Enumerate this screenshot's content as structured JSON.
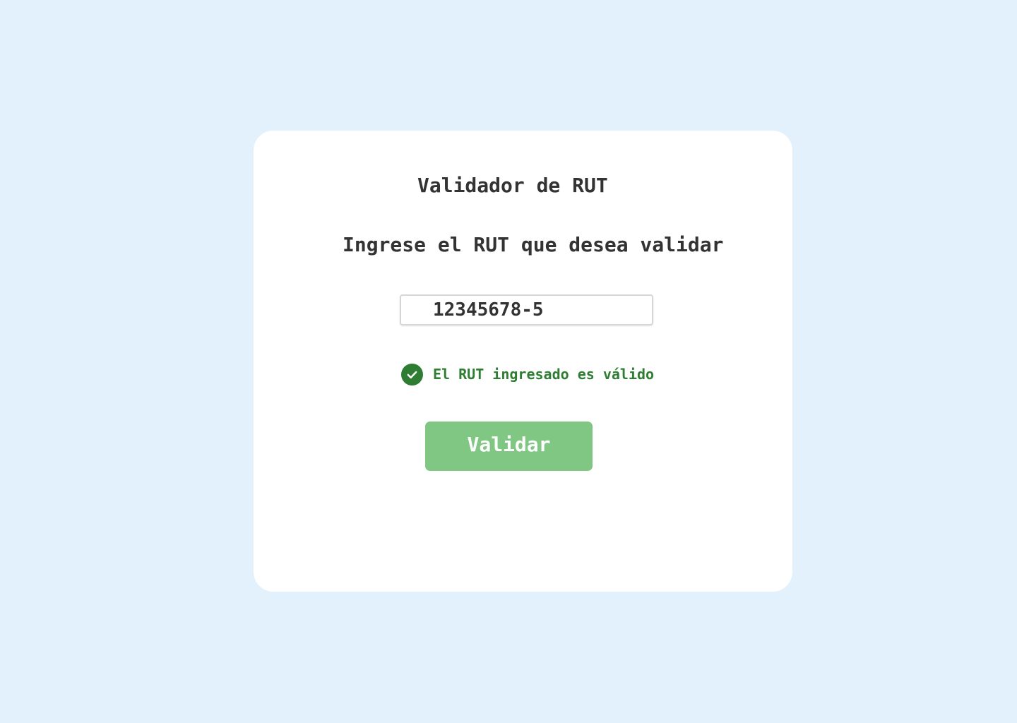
{
  "title": "Validador de RUT",
  "subtitle": "Ingrese el RUT que desea validar",
  "rut_input": {
    "value": "12345678-5"
  },
  "status": {
    "icon": "check-circle-icon",
    "message": "El RUT ingresado es válido",
    "color": "#2e7d32"
  },
  "validate_button": {
    "label": "Validar",
    "color": "#81c784"
  },
  "colors": {
    "background": "#e3f1fc",
    "card": "#ffffff",
    "text": "#333333"
  }
}
